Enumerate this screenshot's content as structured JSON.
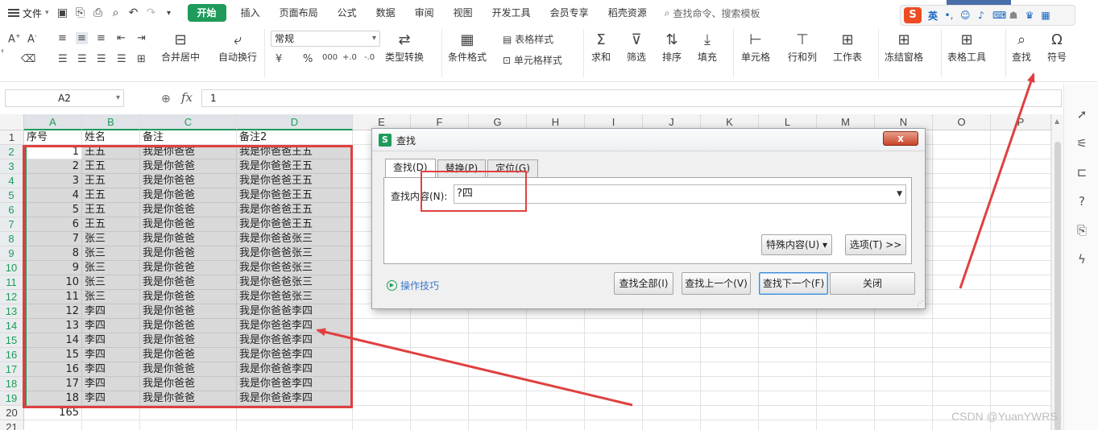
{
  "menubar": {
    "file_label": "文件",
    "tabs": [
      "开始",
      "插入",
      "页面布局",
      "公式",
      "数据",
      "审阅",
      "视图",
      "开发工具",
      "会员专享",
      "稻壳资源"
    ],
    "search_placeholder": "查找命令、搜索模板",
    "ime_label": "英"
  },
  "ribbon": {
    "merge": "合并居中",
    "wrap": "自动换行",
    "number_format": "常规",
    "currency": "¥",
    "percent": "%",
    "thousands": "000",
    "dec_inc": "+.0",
    "dec_dec": "-.0",
    "type_convert": "类型转换",
    "table_style": "表格样式",
    "cond_format": "条件格式",
    "cell_style": "单元格样式",
    "sum": "求和",
    "filter": "筛选",
    "sort": "排序",
    "fill": "填充",
    "cell": "单元格",
    "row_col": "行和列",
    "worksheet": "工作表",
    "freeze": "冻结窗格",
    "table_tools": "表格工具",
    "find": "查找",
    "symbol": "符号"
  },
  "formula": {
    "name_box": "A2",
    "fx": "fx",
    "value": "1"
  },
  "sheet": {
    "columns": [
      "A",
      "B",
      "C",
      "D",
      "E",
      "F",
      "G",
      "H",
      "I",
      "J",
      "K",
      "L",
      "M",
      "N",
      "O",
      "P"
    ],
    "row_numbers": [
      "1",
      "2",
      "3",
      "4",
      "5",
      "6",
      "7",
      "8",
      "9",
      "10",
      "11",
      "12",
      "13",
      "14",
      "15",
      "16",
      "17",
      "18",
      "19",
      "20",
      "21"
    ],
    "header": [
      "序号",
      "姓名",
      "备注",
      "备注2"
    ],
    "rows": [
      [
        "1",
        "王五",
        "我是你爸爸",
        "我是你爸爸王五"
      ],
      [
        "2",
        "王五",
        "我是你爸爸",
        "我是你爸爸王五"
      ],
      [
        "3",
        "王五",
        "我是你爸爸",
        "我是你爸爸王五"
      ],
      [
        "4",
        "王五",
        "我是你爸爸",
        "我是你爸爸王五"
      ],
      [
        "5",
        "王五",
        "我是你爸爸",
        "我是你爸爸王五"
      ],
      [
        "6",
        "王五",
        "我是你爸爸",
        "我是你爸爸王五"
      ],
      [
        "7",
        "张三",
        "我是你爸爸",
        "我是你爸爸张三"
      ],
      [
        "8",
        "张三",
        "我是你爸爸",
        "我是你爸爸张三"
      ],
      [
        "9",
        "张三",
        "我是你爸爸",
        "我是你爸爸张三"
      ],
      [
        "10",
        "张三",
        "我是你爸爸",
        "我是你爸爸张三"
      ],
      [
        "11",
        "张三",
        "我是你爸爸",
        "我是你爸爸张三"
      ],
      [
        "12",
        "李四",
        "我是你爸爸",
        "我是你爸爸李四"
      ],
      [
        "13",
        "李四",
        "我是你爸爸",
        "我是你爸爸李四"
      ],
      [
        "14",
        "李四",
        "我是你爸爸",
        "我是你爸爸李四"
      ],
      [
        "15",
        "李四",
        "我是你爸爸",
        "我是你爸爸李四"
      ],
      [
        "16",
        "李四",
        "我是你爸爸",
        "我是你爸爸李四"
      ],
      [
        "17",
        "李四",
        "我是你爸爸",
        "我是你爸爸李四"
      ],
      [
        "18",
        "李四",
        "我是你爸爸",
        "我是你爸爸李四"
      ]
    ],
    "sum_value": "165"
  },
  "dialog": {
    "title": "查找",
    "close": "x",
    "tabs": [
      "查找(D)",
      "替换(P)",
      "定位(G)"
    ],
    "find_label": "查找内容(N):",
    "find_value": "?四",
    "special_btn": "特殊内容(U) ▾",
    "options_btn": "选项(T) >>",
    "tips": "操作技巧",
    "find_all": "查找全部(I)",
    "find_prev": "查找上一个(V)",
    "find_next": "查找下一个(F)",
    "close_btn": "关闭"
  },
  "watermark": "CSDN @YuanYWRS",
  "colors": {
    "accent": "#1e9b5a",
    "annotation_red": "#e04040"
  }
}
